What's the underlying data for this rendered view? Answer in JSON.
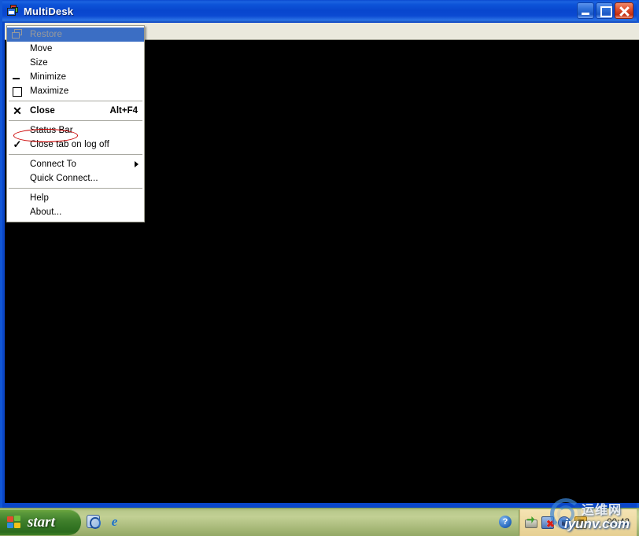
{
  "window": {
    "title": "MultiDesk",
    "icon": "multidesk-window-icon",
    "buttons": {
      "minimize": "minimize-button",
      "maximize": "maximize-button",
      "close": "close-button"
    }
  },
  "system_menu": {
    "items": [
      {
        "label": "Restore",
        "mnemonic": "R",
        "icon": "restore-icon",
        "accel": "",
        "state": "disabled-selected",
        "type": "item"
      },
      {
        "label": "Move",
        "mnemonic": "M",
        "icon": "",
        "accel": "",
        "state": "normal",
        "type": "item"
      },
      {
        "label": "Size",
        "mnemonic": "S",
        "icon": "",
        "accel": "",
        "state": "normal",
        "type": "item"
      },
      {
        "label": "Minimize",
        "mnemonic": "n",
        "icon": "minimize-icon",
        "accel": "",
        "state": "normal",
        "type": "item"
      },
      {
        "label": "Maximize",
        "mnemonic": "x",
        "icon": "maximize-icon",
        "accel": "",
        "state": "normal",
        "type": "item"
      },
      {
        "type": "separator"
      },
      {
        "label": "Close",
        "mnemonic": "C",
        "icon": "close-x-icon",
        "accel": "Alt+F4",
        "state": "bold",
        "type": "item"
      },
      {
        "type": "separator"
      },
      {
        "label": "Status Bar",
        "mnemonic": "B",
        "icon": "",
        "accel": "",
        "state": "normal",
        "type": "item"
      },
      {
        "label": "Close tab on log off",
        "mnemonic": "t",
        "icon": "check-icon",
        "accel": "",
        "state": "checked",
        "type": "item"
      },
      {
        "type": "separator"
      },
      {
        "label": "Connect To",
        "mnemonic": "o",
        "icon": "",
        "accel": "",
        "state": "submenu",
        "type": "item"
      },
      {
        "label": "Quick Connect...",
        "mnemonic": "Q",
        "icon": "",
        "accel": "",
        "state": "normal",
        "type": "item"
      },
      {
        "type": "separator"
      },
      {
        "label": "Help",
        "mnemonic": "H",
        "icon": "",
        "accel": "",
        "state": "normal",
        "type": "item"
      },
      {
        "label": "About...",
        "mnemonic": "A",
        "icon": "",
        "accel": "",
        "state": "normal",
        "type": "item"
      }
    ],
    "annotation": {
      "target": "Status Bar",
      "shape": "ellipse",
      "color": "#cc0000"
    }
  },
  "taskbar": {
    "start_label": "start",
    "start_icon": "windows-flag-icon",
    "quick_launch": [
      {
        "name": "show-desktop-icon"
      },
      {
        "name": "internet-explorer-icon"
      }
    ],
    "help_orb": "?",
    "tray_icons": [
      {
        "name": "printer-install-icon"
      },
      {
        "name": "network-disconnected-icon"
      },
      {
        "name": "volume-icon"
      },
      {
        "name": "security-shield-icon"
      }
    ],
    "clock": "00:42"
  },
  "watermark": {
    "chinese": "运维网",
    "url": "iyunv.com"
  },
  "colors": {
    "titlebar_blue": "#0a46c8",
    "menu_highlight": "#3b6ec4",
    "tabstrip_beige": "#eae9dd",
    "session_black": "#000000",
    "taskbar_green": "#b2c284",
    "tray_tan": "#efdca6",
    "annotation_red": "#cc0000"
  }
}
